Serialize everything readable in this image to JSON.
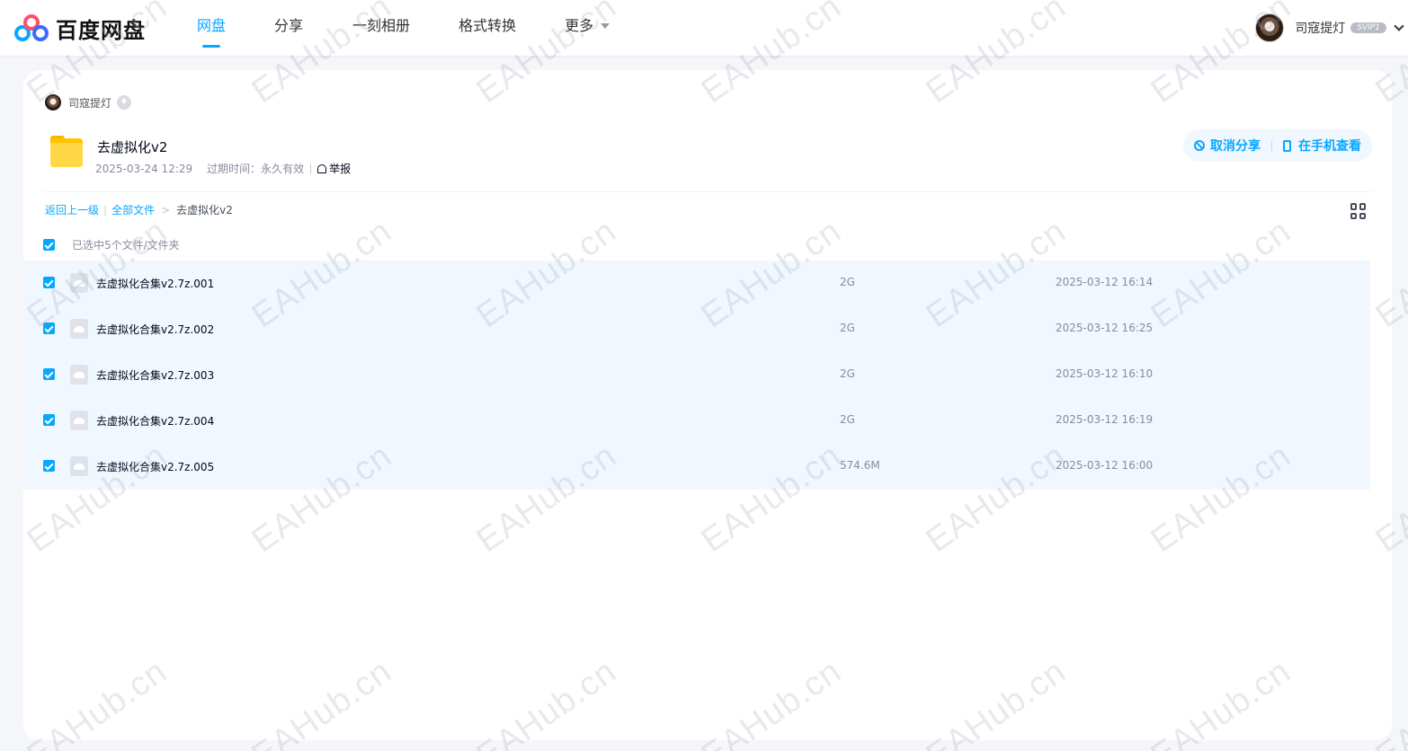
{
  "header": {
    "logo_text": "百度网盘",
    "nav": [
      {
        "label": "网盘",
        "active": true
      },
      {
        "label": "分享",
        "active": false
      },
      {
        "label": "一刻相册",
        "active": false
      },
      {
        "label": "格式转换",
        "active": false
      },
      {
        "label": "更多",
        "active": false
      }
    ],
    "user_name": "司寇提灯",
    "vip_label": "SVIP1"
  },
  "share": {
    "sharer_name": "司寇提灯",
    "title": "去虚拟化v2",
    "date": "2025-03-24 12:29",
    "expire_label": "过期时间：",
    "expire_value": "永久有效",
    "report_label": "举报",
    "cancel_share_label": "取消分享",
    "view_on_phone_label": "在手机查看"
  },
  "breadcrumb": {
    "back_label": "返回上一级",
    "all_files_label": "全部文件",
    "current": "去虚拟化v2"
  },
  "selection_label": "已选中5个文件/文件夹",
  "files": [
    {
      "name": "去虚拟化合集v2.7z.001",
      "size": "2G",
      "time": "2025-03-12 16:14",
      "checked": true
    },
    {
      "name": "去虚拟化合集v2.7z.002",
      "size": "2G",
      "time": "2025-03-12 16:25",
      "checked": true
    },
    {
      "name": "去虚拟化合集v2.7z.003",
      "size": "2G",
      "time": "2025-03-12 16:10",
      "checked": true
    },
    {
      "name": "去虚拟化合集v2.7z.004",
      "size": "2G",
      "time": "2025-03-12 16:19",
      "checked": true
    },
    {
      "name": "去虚拟化合集v2.7z.005",
      "size": "574.6M",
      "time": "2025-03-12 16:00",
      "checked": true
    }
  ],
  "watermark_text": "EAHub.cn",
  "colors": {
    "accent": "#06a7ff",
    "row_selected": "#f0f7ff",
    "page_bg": "#f5f6f9"
  }
}
